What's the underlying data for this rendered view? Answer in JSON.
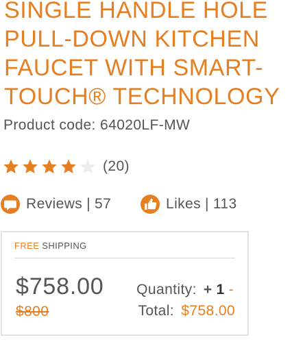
{
  "product": {
    "title_lines": [
      "SINGLE HANDLE HOLE",
      "PULL-DOWN KITCHEN",
      "FAUCET WITH SMART-",
      "TOUCH® TECHNOLOGY"
    ],
    "code_label": "Product code:",
    "code_value": "64020LF-MW"
  },
  "rating": {
    "stars_filled": 4,
    "stars_total": 5,
    "count_text": "(20)"
  },
  "social": {
    "reviews_icon": "speech-bubble-icon",
    "reviews_label": "Reviews",
    "reviews_sep": "|",
    "reviews_count": "57",
    "likes_icon": "thumbs-up-icon",
    "likes_label": "Likes",
    "likes_sep": "|",
    "likes_count": "113"
  },
  "purchase": {
    "shipping_free": "FREE",
    "shipping_label": "SHIPPING",
    "price": "$758.00",
    "old_price": "$800",
    "quantity_label": "Quantity:",
    "quantity_plus": "+",
    "quantity_value": "1",
    "quantity_minus": "-",
    "total_label": "Total:",
    "total_value": "$758.00"
  },
  "colors": {
    "accent": "#e67e22",
    "text": "#555555",
    "star_empty": "#eeeeee",
    "border": "#e3e3e3"
  }
}
